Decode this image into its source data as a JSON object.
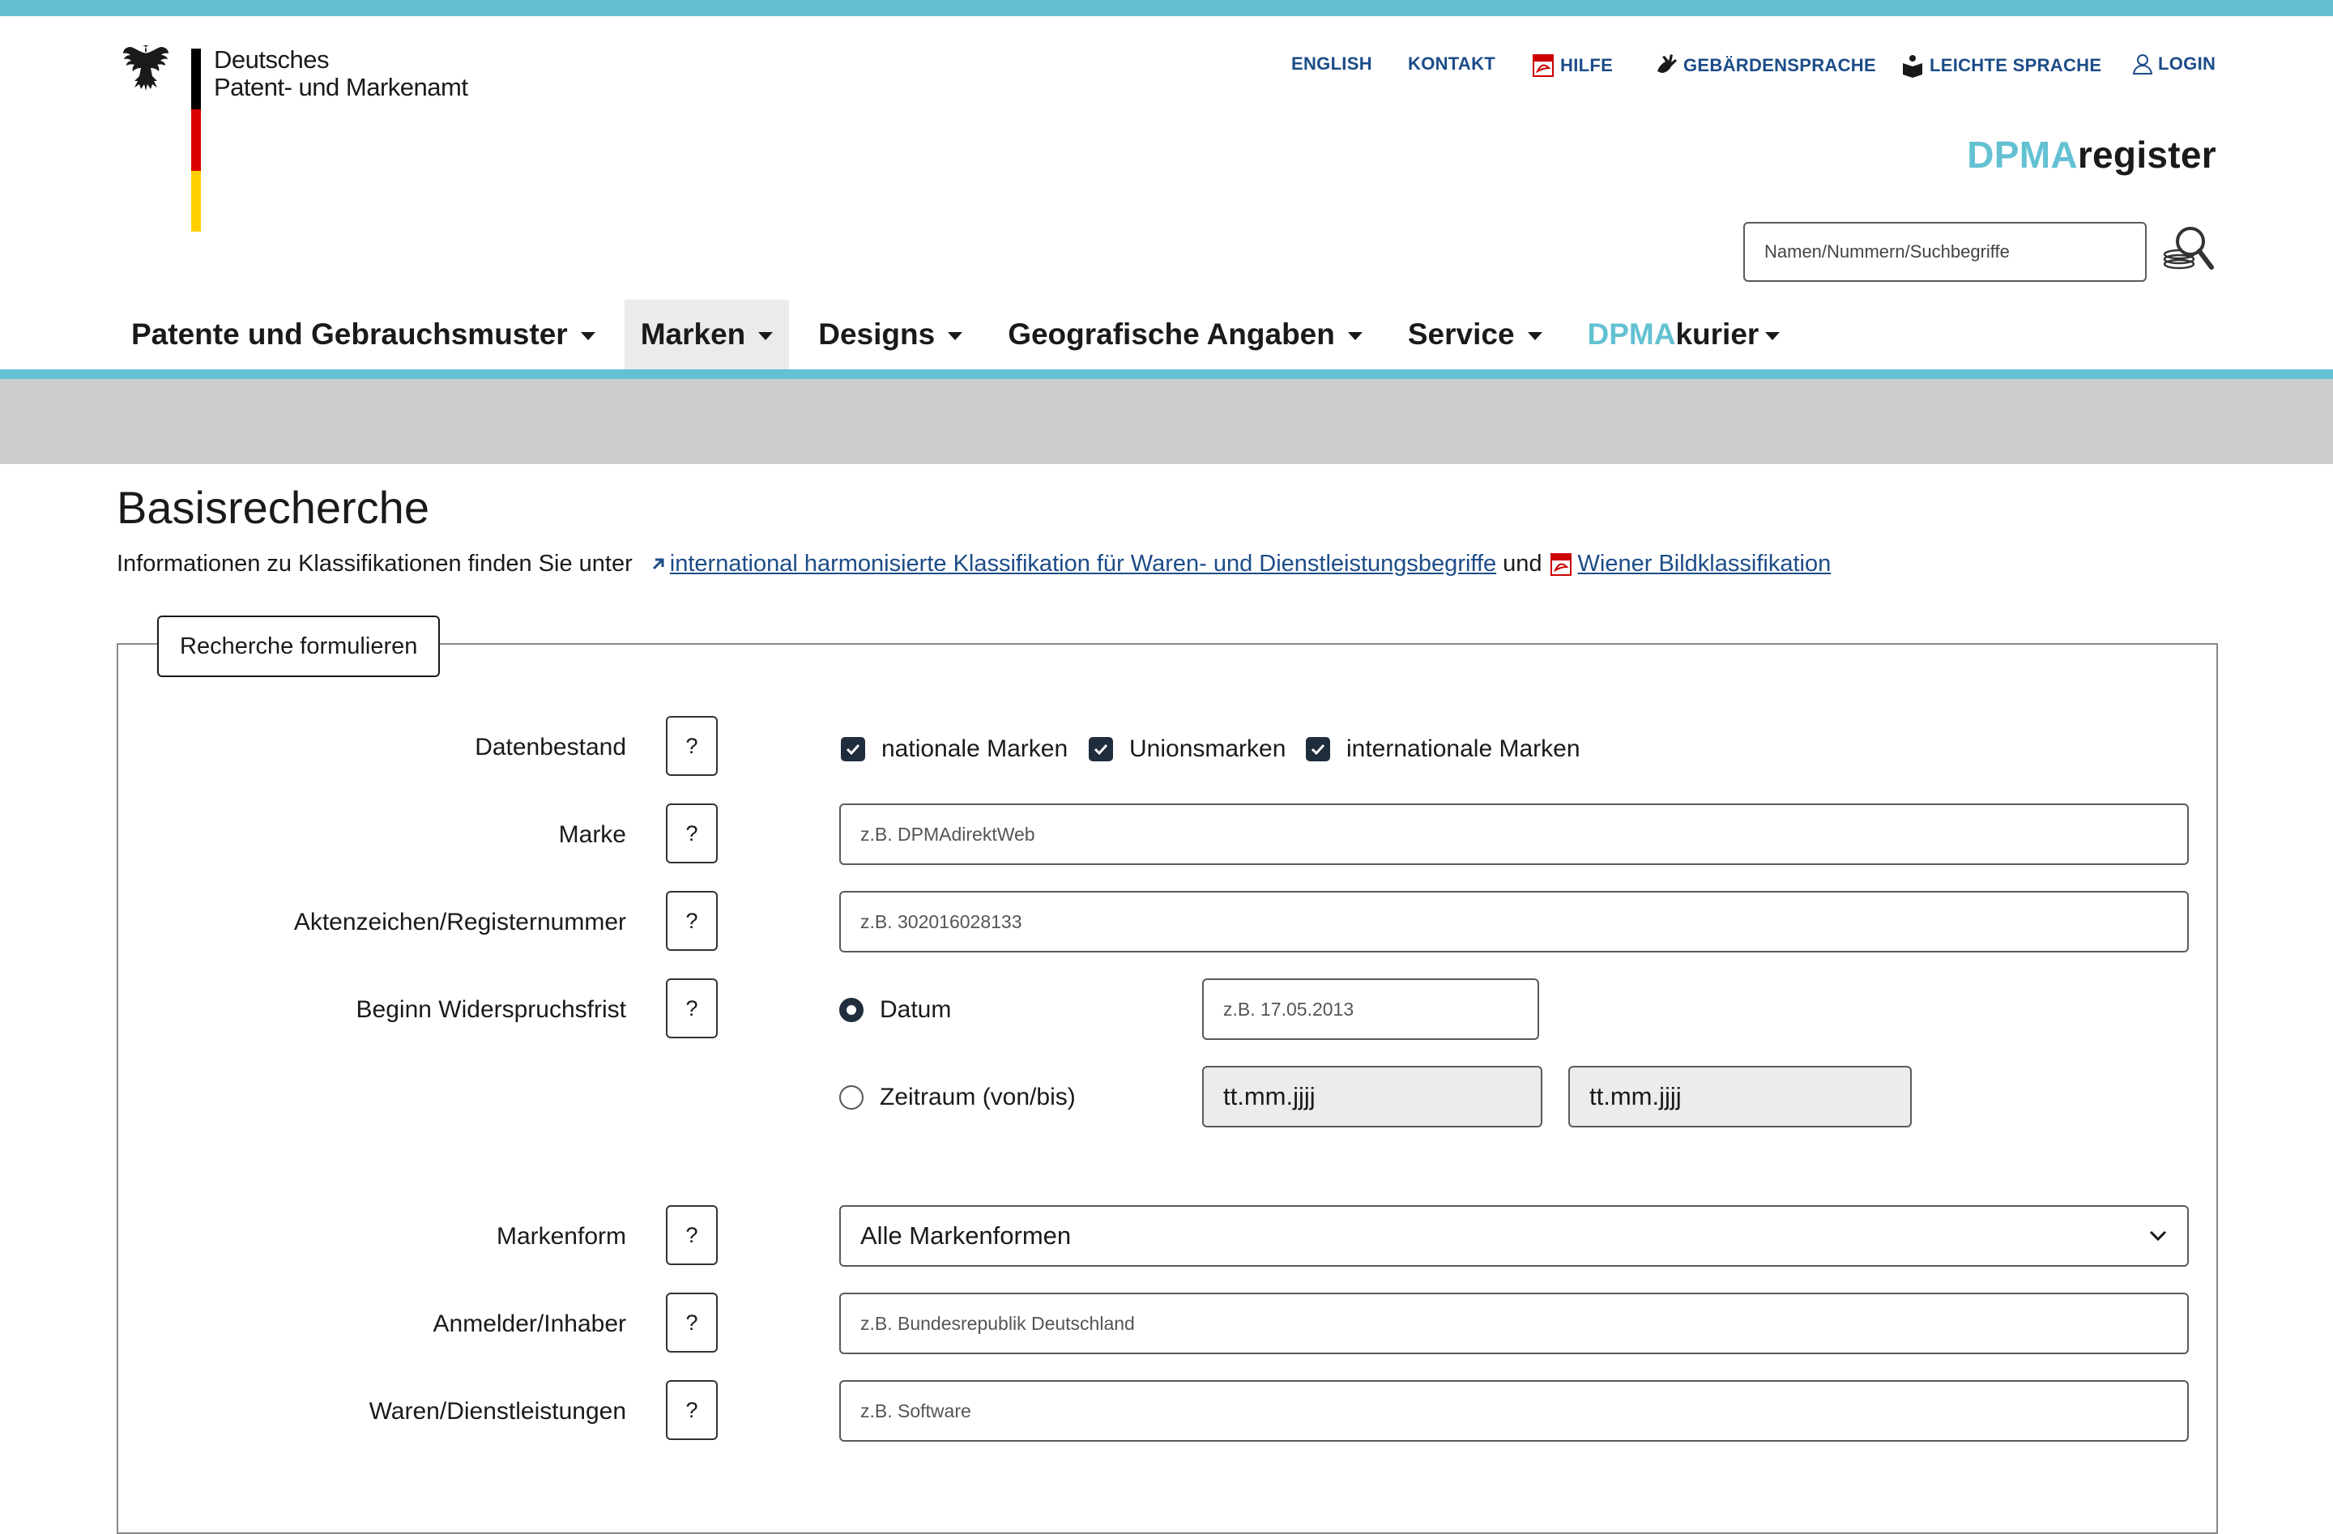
{
  "colors": {
    "accent": "#63c1d2",
    "link": "#1c4c88",
    "text": "#1a1a1a",
    "gray_band": "#cccccc"
  },
  "header": {
    "org_line1": "Deutsches",
    "org_line2": "Patent- und Markenamt",
    "meta_links": [
      {
        "label": "ENGLISH",
        "icon": ""
      },
      {
        "label": "KONTAKT",
        "icon": ""
      },
      {
        "label": "HILFE",
        "icon": "pdf-icon"
      },
      {
        "label": "GEBÄRDENSPRACHE",
        "icon": "sign-language-icon"
      },
      {
        "label": "LEICHTE SPRACHE",
        "icon": "easy-language-icon"
      },
      {
        "label": "LOGIN",
        "icon": "user-icon"
      }
    ],
    "app_name_accent": "DPMA",
    "app_name_rest": "register",
    "search_placeholder": "Namen/Nummern/Suchbegriffe",
    "search_icon": "magnifier-icon"
  },
  "nav": {
    "items": [
      {
        "label": "Patente und Gebrauchsmuster"
      },
      {
        "label": "Marken",
        "active": true
      },
      {
        "label": "Designs"
      },
      {
        "label": "Geografische Angaben"
      },
      {
        "label": "Service"
      },
      {
        "label_accent": "DPMA",
        "label_rest": "kurier"
      }
    ]
  },
  "page": {
    "title": "Basisrecherche",
    "info_prefix": "Informationen zu Klassifikationen finden Sie unter",
    "link1": "international harmonisierte Klassifikation für Waren- und Dienstleistungsbegriffe",
    "info_mid": "und",
    "link2": "Wiener Bildklassifikation"
  },
  "form": {
    "legend": "Recherche formulieren",
    "help_label": "?",
    "datenbestand": {
      "label": "Datenbestand",
      "options": [
        {
          "label": "nationale Marken",
          "checked": true
        },
        {
          "label": "Unionsmarken",
          "checked": true
        },
        {
          "label": "internationale Marken",
          "checked": true
        }
      ]
    },
    "marke": {
      "label": "Marke",
      "placeholder": "z.B. DPMAdirektWeb"
    },
    "aktenzeichen": {
      "label": "Aktenzeichen/Registernummer",
      "placeholder": "z.B. 302016028133"
    },
    "widerspruch": {
      "label": "Beginn Widerspruchsfrist",
      "radio_datum": "Datum",
      "radio_datum_selected": true,
      "datum_placeholder": "z.B. 17.05.2013",
      "radio_zeitraum": "Zeitraum (von/bis)",
      "von_placeholder": "tt.mm.jjjj",
      "bis_placeholder": "tt.mm.jjjj"
    },
    "markenform": {
      "label": "Markenform",
      "selected": "Alle Markenformen"
    },
    "anmelder": {
      "label": "Anmelder/Inhaber",
      "placeholder": "z.B. Bundesrepublik Deutschland"
    },
    "waren": {
      "label": "Waren/Dienstleistungen",
      "placeholder": "z.B. Software"
    }
  }
}
